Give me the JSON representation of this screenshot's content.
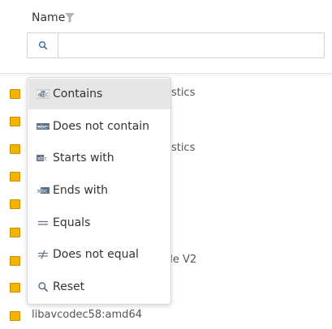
{
  "header": {
    "column_title": "Name"
  },
  "rows": [
    {
      "text": "ostics"
    },
    {
      "text": ""
    },
    {
      "text": "ostics"
    },
    {
      "text": ""
    },
    {
      "text": ""
    },
    {
      "text": ""
    },
    {
      "text": "ule V2"
    },
    {
      "text": ""
    },
    {
      "text": "libavcodec58:amd64"
    }
  ],
  "filter_menu": {
    "items": [
      {
        "label": "Contains",
        "icon": "contains-icon",
        "selected": true
      },
      {
        "label": "Does not contain",
        "icon": "not-contains-icon"
      },
      {
        "label": "Starts with",
        "icon": "starts-with-icon"
      },
      {
        "label": "Ends with",
        "icon": "ends-with-icon"
      },
      {
        "label": "Equals",
        "icon": "equals-icon"
      },
      {
        "label": "Does not equal",
        "icon": "not-equal-icon"
      },
      {
        "label": "Reset",
        "icon": "search-icon"
      }
    ]
  },
  "colors": {
    "row_icon": "#f3b400",
    "selected_bg": "#e6e6e6"
  }
}
